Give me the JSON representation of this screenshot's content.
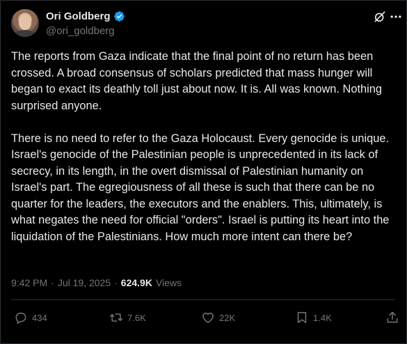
{
  "author": {
    "display_name": "Ori Goldberg",
    "handle": "@ori_goldberg"
  },
  "icons": {
    "verified": "verified-badge-icon",
    "grok": "grok-icon",
    "more": "more-icon",
    "reply": "reply-icon",
    "repost": "repost-icon",
    "like": "like-icon",
    "bookmark": "bookmark-icon",
    "share": "share-icon"
  },
  "colors": {
    "background": "#000000",
    "text": "#e7e9ea",
    "secondary": "#71767b",
    "verified": "#1d9bf0"
  },
  "tweet": {
    "paragraphs": [
      "The reports from Gaza indicate that the final point of no return has been crossed. A broad consensus of scholars predicted that mass hunger will began to exact its deathly toll just about now. It is. All was known. Nothing surprised anyone.",
      "There is no need to refer to the Gaza Holocaust. Every genocide is unique. Israel's genocide of the Palestinian people is unprecedented in its lack of secrecy, in its length, in the overt dismissal of Palestinian humanity on Israel's part. The egregiousness of all these is such that there can be no quarter for the leaders, the executors and the enablers. This, ultimately, is what negates the need for official \"orders\". Israel is putting its heart into the liquidation of the Palestinians. How much more intent can there be?"
    ],
    "time": "9:42 PM",
    "separator": "·",
    "date": "Jul 19, 2025",
    "views_count": "624.9K",
    "views_label": "Views"
  },
  "actions": {
    "replies": "434",
    "reposts": "7.6K",
    "likes": "22K",
    "bookmarks": "1.4K"
  }
}
